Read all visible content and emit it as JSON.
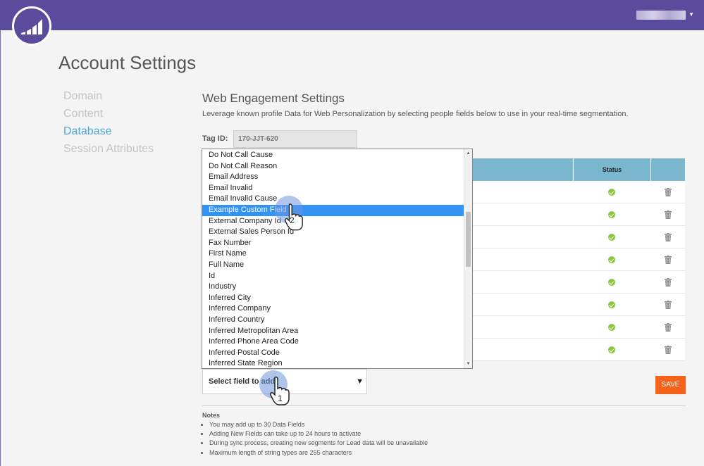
{
  "header": {
    "user_label": ""
  },
  "page": {
    "title": "Account Settings"
  },
  "nav": {
    "items": [
      {
        "label": "Domain",
        "active": false
      },
      {
        "label": "Content",
        "active": false
      },
      {
        "label": "Database",
        "active": true
      },
      {
        "label": "Session Attributes",
        "active": false
      }
    ]
  },
  "section": {
    "title": "Web Engagement Settings",
    "description": "Leverage known profile Data for Web Personalization by selecting people fields below to use in your real-time segmentation."
  },
  "tag": {
    "label": "Tag ID:",
    "value": "170-JJT-620"
  },
  "table": {
    "status_header": "Status",
    "row_count": 8
  },
  "dropdown": {
    "items": [
      "Do Not Call Cause",
      "Do Not Call Reason",
      "Email Address",
      "Email Invalid",
      "Email Invalid Cause",
      "Example Custom Field",
      "External Company Id",
      "External Sales Person Id",
      "Fax Number",
      "First Name",
      "Full Name",
      "Id",
      "Industry",
      "Inferred City",
      "Inferred Company",
      "Inferred Country",
      "Inferred Metropolitan Area",
      "Inferred Phone Area Code",
      "Inferred Postal Code",
      "Inferred State Region"
    ],
    "selected_index": 5,
    "scroll_up_glyph": "▲",
    "scroll_down_glyph": "▼"
  },
  "select": {
    "placeholder": "Select field to add",
    "arrow": "▼"
  },
  "buttons": {
    "save": "SAVE"
  },
  "notes": {
    "title": "Notes",
    "items": [
      "You may add up to 30 Data Fields",
      "Adding New Fields can take up to 24 hours to activate",
      "During sync process, creating new segments for Lead data will be unavailable",
      "Maximum length of string types are 255 characters"
    ]
  },
  "callouts": {
    "step1": "1",
    "step2": "2"
  },
  "colors": {
    "header": "#5a4b9c",
    "accent_nav": "#4aa8d8",
    "table_header": "#7bb8cf",
    "selection": "#3393f5",
    "save": "#f5631b",
    "status_ok": "#8cc63f"
  }
}
